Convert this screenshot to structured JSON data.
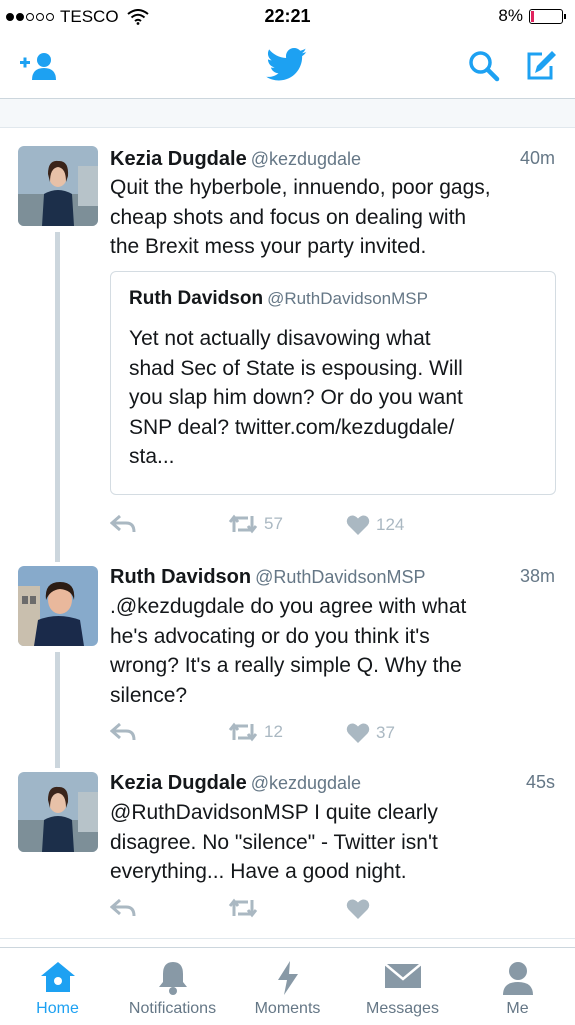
{
  "status_bar": {
    "carrier": "TESCO",
    "time": "22:21",
    "battery": "8%",
    "battery_level": 0.08
  },
  "nav": {
    "icons": [
      "add-user-icon",
      "twitter-bird-icon",
      "search-icon",
      "compose-icon"
    ]
  },
  "tweets": [
    {
      "name": "Kezia Dugdale",
      "handle": "@kezdugdale",
      "time": "40m",
      "lines": [
        "Quit the hyberbole, innuendo, poor gags,",
        "cheap shots and focus on dealing with",
        "the Brexit mess your party invited."
      ],
      "quote": {
        "name": "Ruth Davidson",
        "handle": "@RuthDavidsonMSP",
        "lines": [
          "Yet not actually disavowing what",
          "shad Sec of State is espousing. Will",
          "you slap him down? Or do you want",
          "SNP deal? twitter.com/kezdugdale/",
          "sta..."
        ]
      },
      "retweets": "57",
      "likes": "124"
    },
    {
      "name": "Ruth Davidson",
      "handle": "@RuthDavidsonMSP",
      "time": "38m",
      "lines": [
        ".@kezdugdale do you agree with what",
        "he's  advocating or do you think it's",
        "wrong? It's a really simple Q. Why the",
        "silence?"
      ],
      "retweets": "12",
      "likes": "37"
    },
    {
      "name": "Kezia Dugdale",
      "handle": "@kezdugdale",
      "time": "45s",
      "lines": [
        "@RuthDavidsonMSP I quite clearly",
        "disagree. No \"silence\" - Twitter isn't",
        "everything... Have a good night."
      ],
      "retweets": "",
      "likes": ""
    }
  ],
  "tabs": [
    {
      "label": "Home",
      "icon": "home-icon",
      "active": true
    },
    {
      "label": "Notifications",
      "icon": "bell-icon",
      "active": false
    },
    {
      "label": "Moments",
      "icon": "lightning-icon",
      "active": false
    },
    {
      "label": "Messages",
      "icon": "envelope-icon",
      "active": false
    },
    {
      "label": "Me",
      "icon": "person-icon",
      "active": false
    }
  ],
  "colors": {
    "accent": "#1da1f2",
    "muted": "#657786",
    "icon_gray": "#aab8c2",
    "text": "#14171a"
  }
}
